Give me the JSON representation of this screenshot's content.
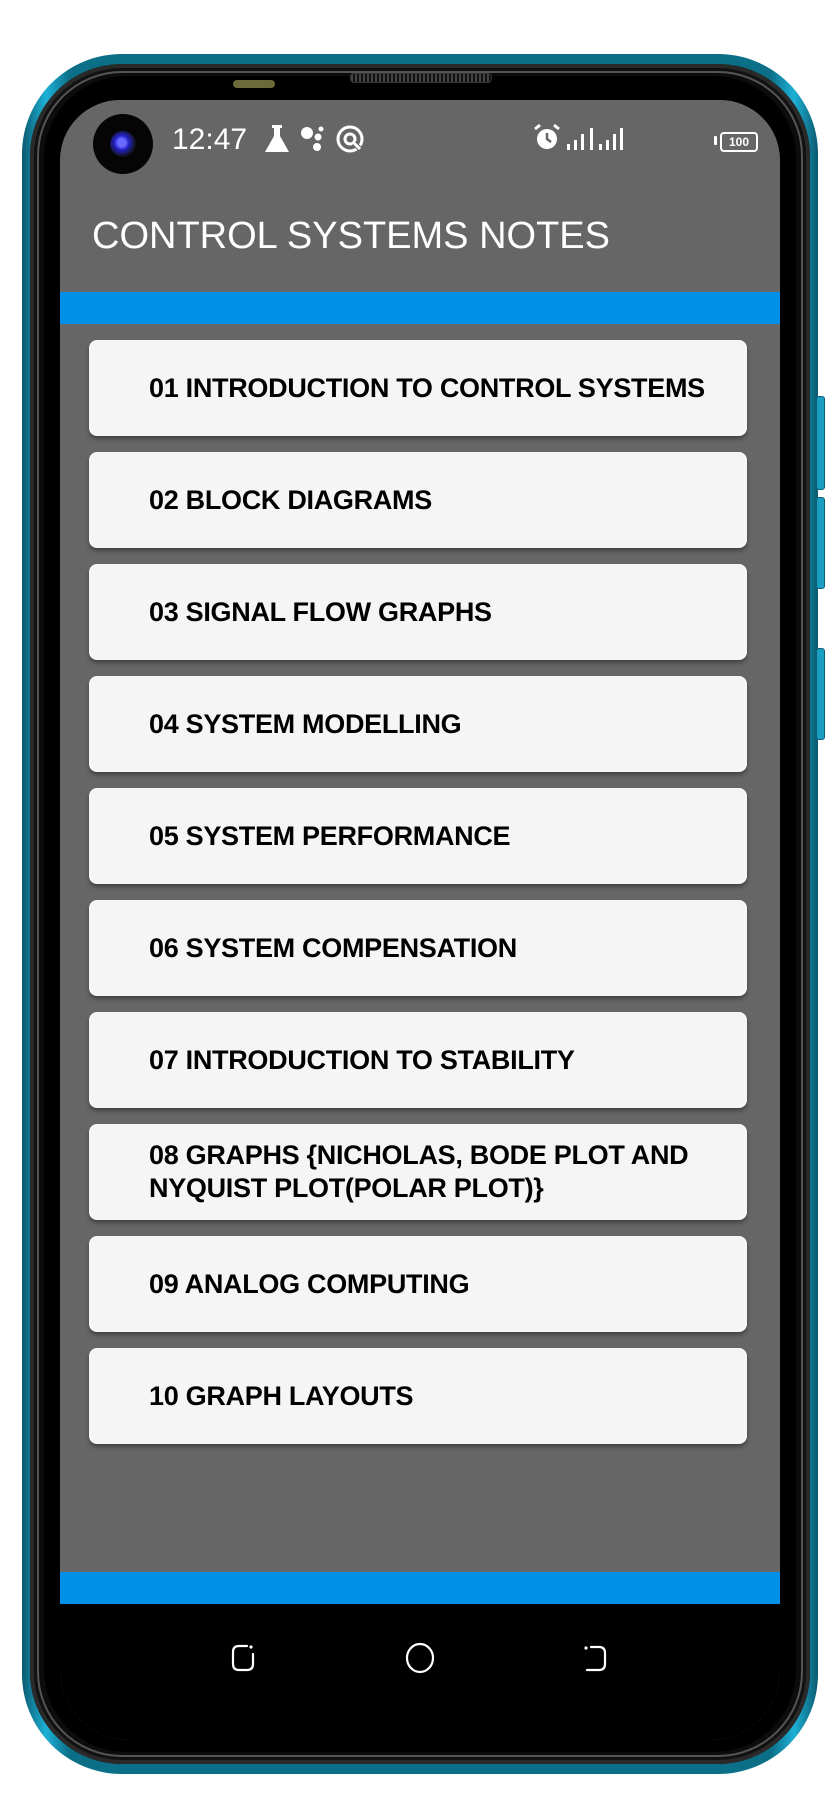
{
  "status_bar": {
    "time": "12:47",
    "left_icons": [
      "flask-icon",
      "assistant-dots-icon",
      "data-saver-icon"
    ],
    "right_icons": [
      "alarm-icon",
      "signal-sim1-icon",
      "signal-sim2-icon"
    ],
    "battery_level": "100"
  },
  "app": {
    "title": "CONTROL SYSTEMS NOTES",
    "accent_color": "#0091e6",
    "background_color": "#666666",
    "card_color": "#f5f5f5"
  },
  "chapters": [
    {
      "label": "01 INTRODUCTION TO CONTROL SYSTEMS"
    },
    {
      "label": "02 BLOCK DIAGRAMS"
    },
    {
      "label": "03 SIGNAL FLOW GRAPHS"
    },
    {
      "label": "04 SYSTEM MODELLING"
    },
    {
      "label": "05 SYSTEM PERFORMANCE"
    },
    {
      "label": "06 SYSTEM COMPENSATION"
    },
    {
      "label": "07 INTRODUCTION TO STABILITY"
    },
    {
      "label": "08 GRAPHS {NICHOLAS, BODE PLOT AND NYQUIST PLOT(POLAR PLOT)}"
    },
    {
      "label": "09 ANALOG COMPUTING"
    },
    {
      "label": "10 GRAPH LAYOUTS"
    }
  ],
  "nav_bar": {
    "buttons": [
      "recents",
      "home",
      "back"
    ]
  }
}
